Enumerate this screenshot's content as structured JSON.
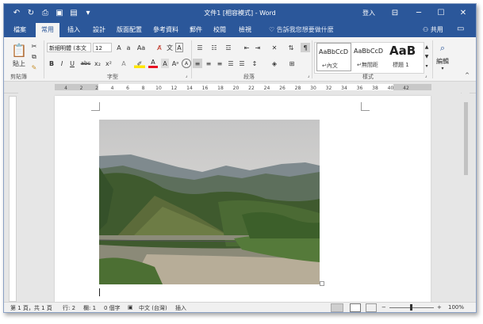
{
  "title_bar": {
    "title": "文件1 [相容模式] - Word",
    "login_label": "登入",
    "qat_icons": [
      "undo-icon",
      "redo-icon",
      "print-preview-icon",
      "save-icon",
      "save-as-icon",
      "customize-qat-icon"
    ],
    "window_buttons": [
      "ribbon-display-icon",
      "minimize-icon",
      "maximize-icon",
      "close-icon"
    ]
  },
  "tabs": {
    "items": [
      "檔案",
      "常用",
      "插入",
      "設計",
      "版面配置",
      "參考資料",
      "郵件",
      "校閱",
      "檢視"
    ],
    "active": "常用",
    "tell_me": "告訴我您想要做什麼",
    "share": "共用"
  },
  "ribbon": {
    "clipboard": {
      "paste_label": "貼上",
      "group_label": "剪貼簿"
    },
    "font": {
      "font_name": "新細明體 (本文",
      "font_size": "12",
      "group_label": "字型",
      "buttons": [
        "B",
        "I",
        "U",
        "abc",
        "x₂",
        "x²",
        "A",
        "Aa",
        "A",
        "A",
        "Aᵃ",
        "A"
      ]
    },
    "paragraph": {
      "group_label": "段落"
    },
    "styles": {
      "group_label": "樣式",
      "items": [
        {
          "preview": "AaBbCcD",
          "name": "↵內文"
        },
        {
          "preview": "AaBbCcD",
          "name": "↵無間距"
        },
        {
          "preview": "AaB",
          "name": "標題 1"
        }
      ]
    },
    "editing": {
      "label": "編輯"
    }
  },
  "ruler": {
    "marks": [
      "4",
      "2",
      "2",
      "4",
      "6",
      "8",
      "10",
      "12",
      "14",
      "16",
      "18",
      "20",
      "22",
      "24",
      "26",
      "28",
      "30",
      "32",
      "34",
      "36",
      "38",
      "40",
      "42"
    ]
  },
  "status_bar": {
    "page_info": "第 1 頁，共 1 頁",
    "line": "行: 2",
    "column": "欄: 1",
    "word_count": "0 個字",
    "language": "中文 (台灣)",
    "mode": "插入",
    "zoom": "100%"
  },
  "colors": {
    "title_blue": "#2b579a",
    "ribbon_bg": "#f3f3f3",
    "canvas_bg": "#e6e6e6"
  }
}
